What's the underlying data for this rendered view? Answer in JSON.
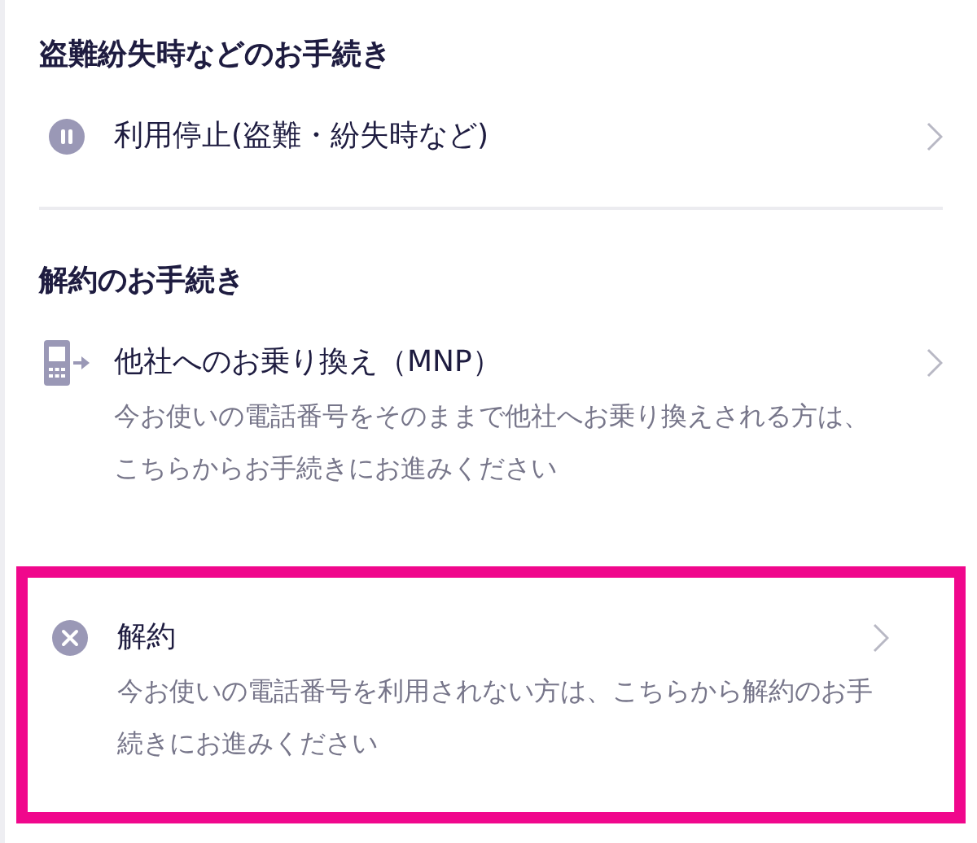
{
  "sections": [
    {
      "heading": "盗難紛失時などのお手続き",
      "items": [
        {
          "kind": "pause",
          "label": "利用停止(盗難・紛失時など)",
          "highlighted": false
        }
      ]
    },
    {
      "heading": "解約のお手続き",
      "items": [
        {
          "kind": "phone-transfer",
          "label": "他社へのお乗り換え（MNP）",
          "description": "今お使いの電話番号をそのままで他社へお乗り換えされる方は、こちらからお手続きにお進みください",
          "highlighted": false
        },
        {
          "kind": "cancel",
          "label": "解約",
          "description": "今お使いの電話番号を利用されない方は、こちらから解約のお手続きにお進みください",
          "highlighted": true
        }
      ]
    }
  ]
}
